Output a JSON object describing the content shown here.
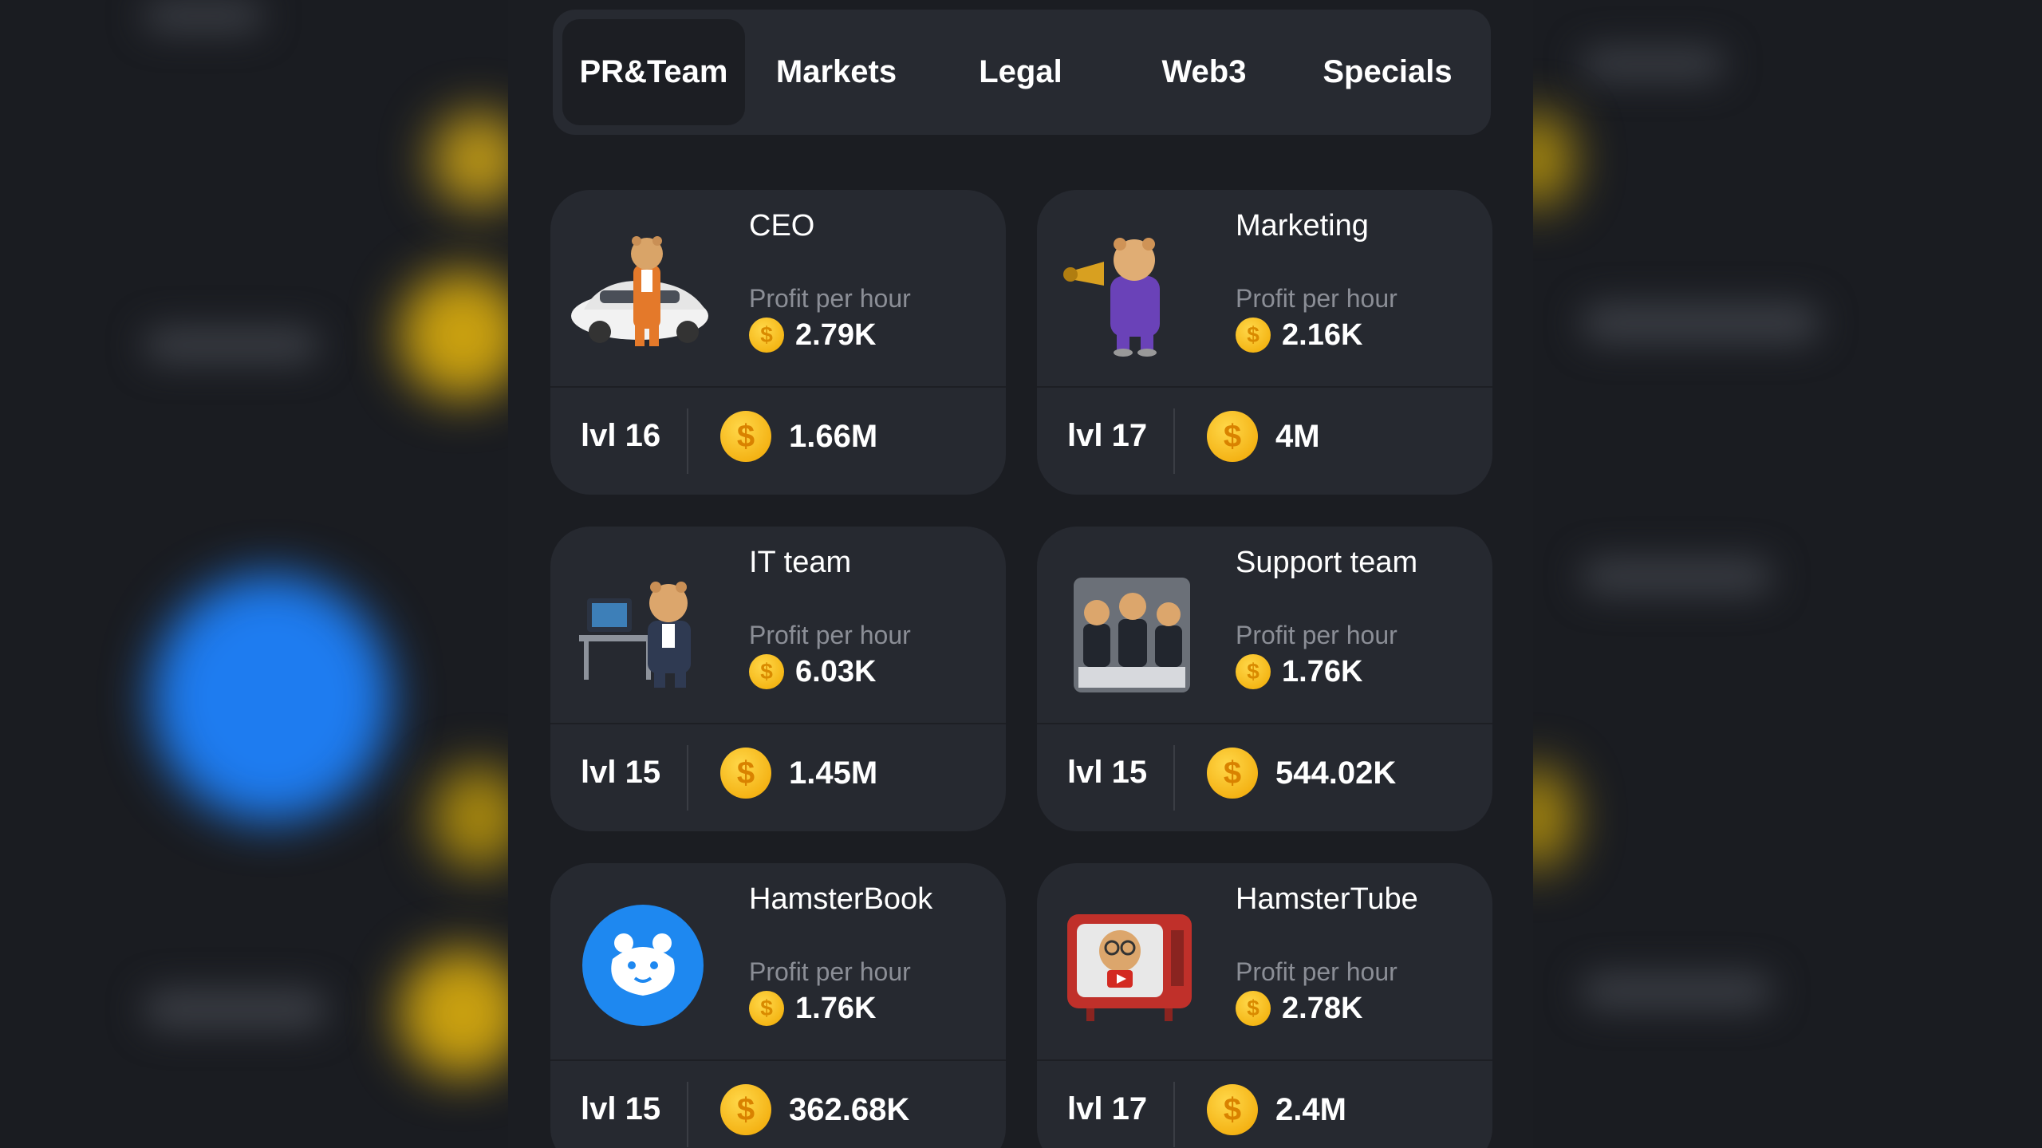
{
  "tabs": [
    {
      "label": "PR&Team",
      "active": true
    },
    {
      "label": "Markets",
      "active": false
    },
    {
      "label": "Legal",
      "active": false
    },
    {
      "label": "Web3",
      "active": false
    },
    {
      "label": "Specials",
      "active": false
    }
  ],
  "profit_label": "Profit per hour",
  "cards": [
    {
      "name": "CEO",
      "profit": "2.79K",
      "level": "lvl 16",
      "cost": "1.66M",
      "icon": "hamster-ceo-car-icon"
    },
    {
      "name": "Marketing",
      "profit": "2.16K",
      "level": "lvl 17",
      "cost": "4M",
      "icon": "hamster-megaphone-icon"
    },
    {
      "name": "IT team",
      "profit": "6.03K",
      "level": "lvl 15",
      "cost": "1.45M",
      "icon": "hamster-computer-desk-icon"
    },
    {
      "name": "Support team",
      "profit": "1.76K",
      "level": "lvl 15",
      "cost": "544.02K",
      "icon": "hamster-support-team-icon"
    },
    {
      "name": "HamsterBook",
      "profit": "1.76K",
      "level": "lvl 15",
      "cost": "362.68K",
      "icon": "hamsterbook-logo-icon"
    },
    {
      "name": "HamsterTube",
      "profit": "2.78K",
      "level": "lvl 17",
      "cost": "2.4M",
      "icon": "hamster-tv-icon"
    }
  ],
  "colors": {
    "background": "#1b1d22",
    "card": "#262930",
    "coin": "#f5b800",
    "hamsterbook_blue": "#1e88f0"
  }
}
